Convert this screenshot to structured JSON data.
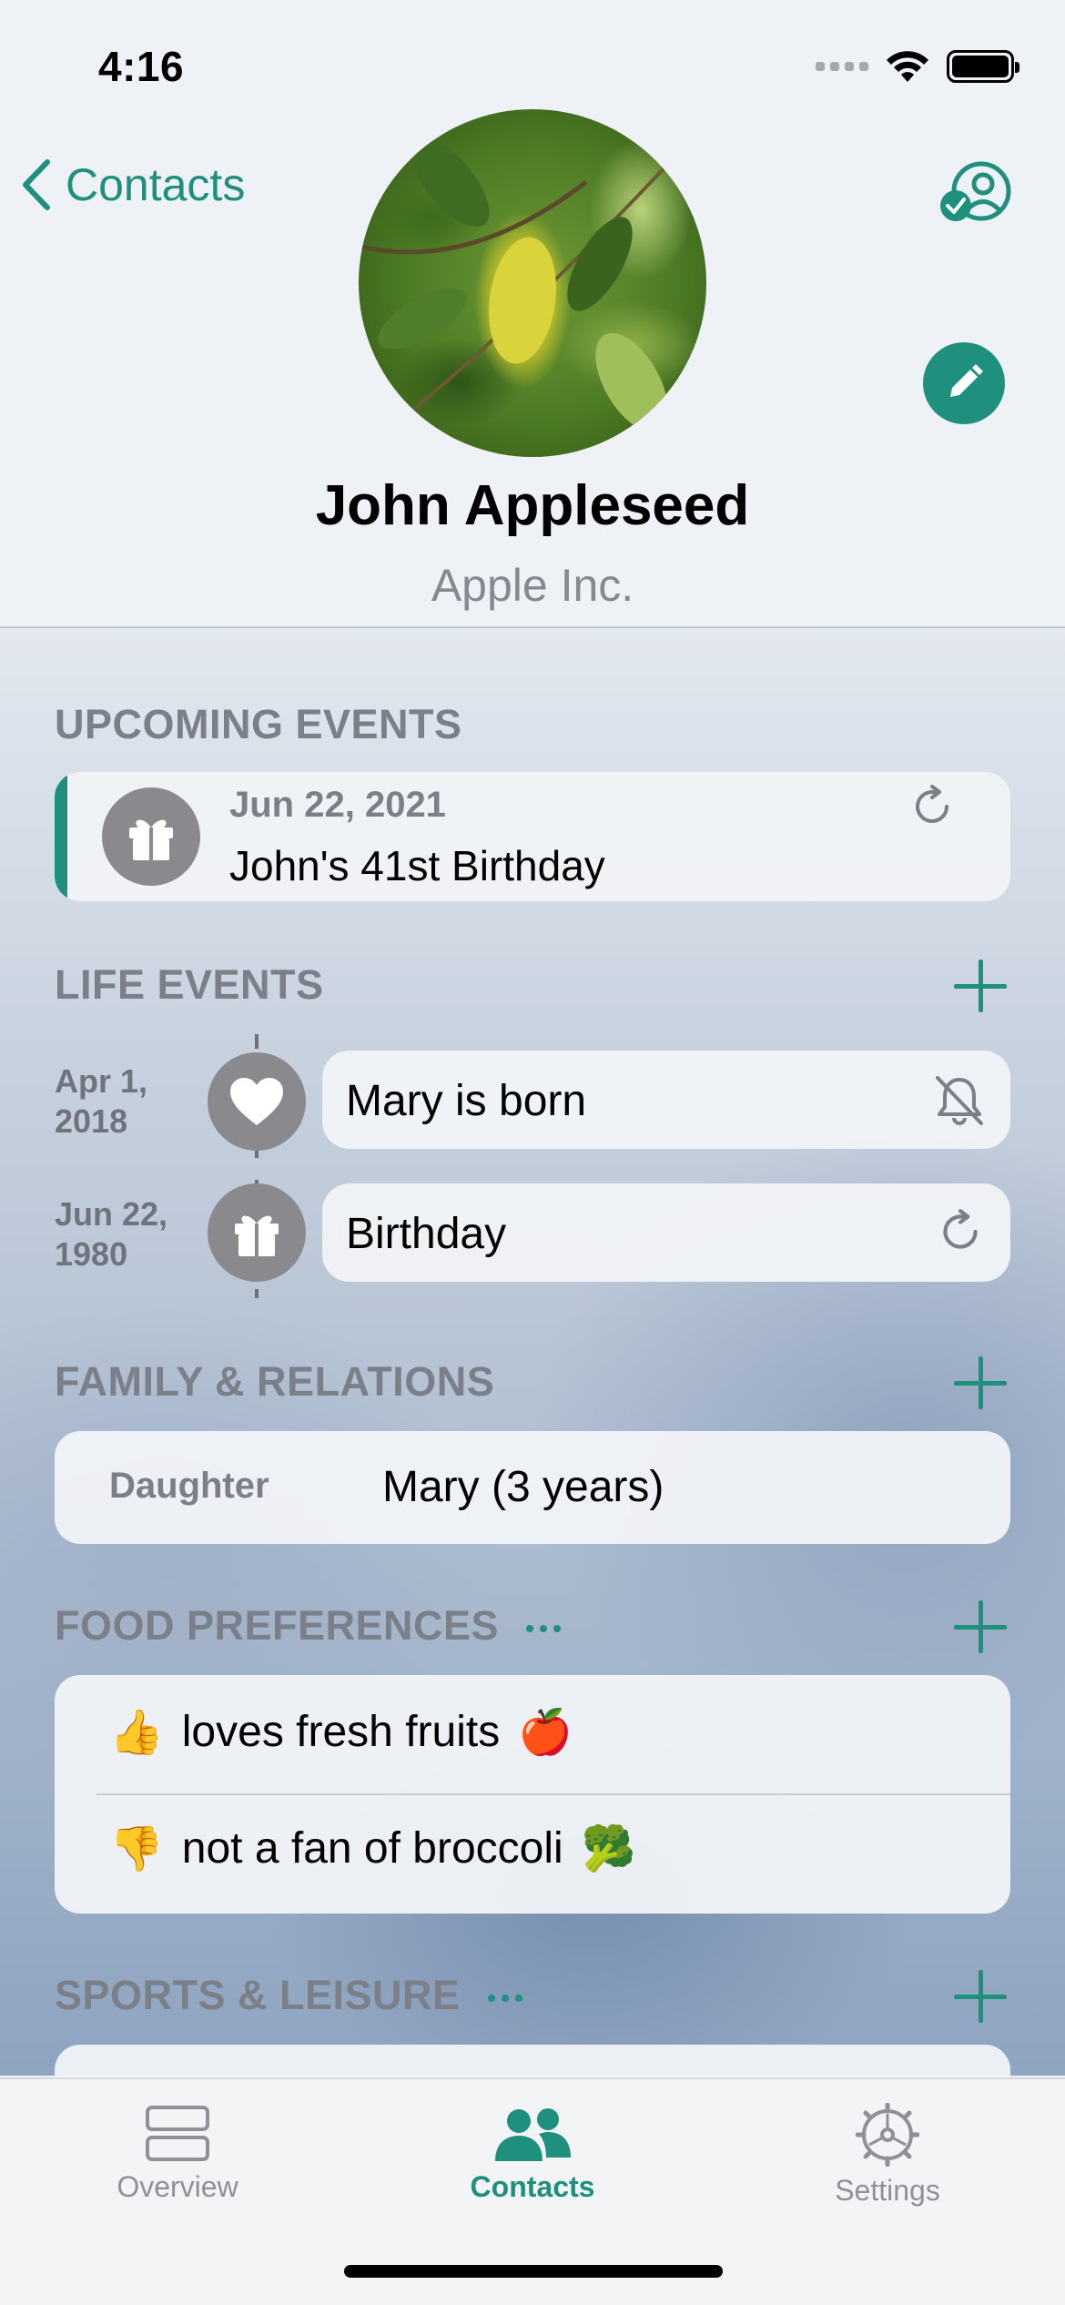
{
  "status_bar": {
    "time": "4:16"
  },
  "nav": {
    "back_label": "Contacts"
  },
  "contact": {
    "name": "John Appleseed",
    "company": "Apple Inc."
  },
  "sections": {
    "upcoming": "UPCOMING EVENTS",
    "life": "LIFE EVENTS",
    "family": "FAMILY & RELATIONS",
    "food": "FOOD PREFERENCES",
    "sports": "SPORTS & LEISURE"
  },
  "upcoming_event": {
    "date": "Jun 22, 2021",
    "title": "John's 41st Birthday",
    "icon": "gift-icon"
  },
  "life_events": [
    {
      "date_line1": "Apr 1,",
      "date_line2": "2018",
      "label": "Mary is born",
      "icon": "heart-icon",
      "trailing": "bell-slash-icon"
    },
    {
      "date_line1": "Jun 22,",
      "date_line2": "1980",
      "label": "Birthday",
      "icon": "gift-icon",
      "trailing": "refresh-icon"
    }
  ],
  "family": [
    {
      "relation": "Daughter",
      "value": "Mary (3 years)"
    }
  ],
  "food": [
    {
      "emoji": "👍",
      "text": "loves fresh fruits",
      "emoji_after": "🍎"
    },
    {
      "emoji": "👎",
      "text": "not a fan of broccoli",
      "emoji_after": "🥦"
    }
  ],
  "tabs": [
    {
      "label": "Overview",
      "icon": "overview-icon",
      "active": false
    },
    {
      "label": "Contacts",
      "icon": "people-icon",
      "active": true
    },
    {
      "label": "Settings",
      "icon": "gear-icon",
      "active": false
    }
  ],
  "colors": {
    "accent": "#1f8f7e",
    "icon_gray": "#8a8a8e"
  }
}
